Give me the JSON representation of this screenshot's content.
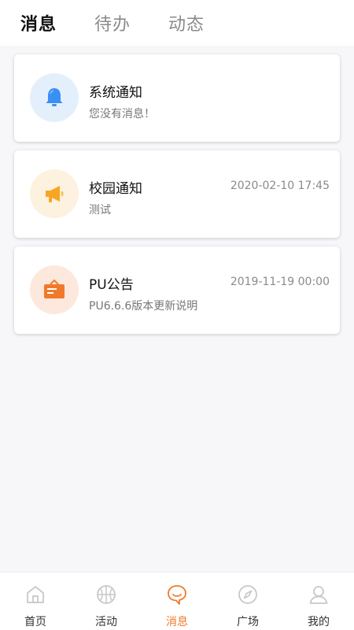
{
  "tabs": [
    {
      "label": "消息",
      "active": true
    },
    {
      "label": "待办",
      "active": false
    },
    {
      "label": "动态",
      "active": false
    }
  ],
  "cards": [
    {
      "title": "系统通知",
      "subtitle": "您没有消息！",
      "time": "",
      "icon": "bell-icon",
      "icon_color": "#3a8ff5",
      "icon_bg": "#e3f0fc"
    },
    {
      "title": "校园通知",
      "subtitle": "测试",
      "time": "2020-02-10 17:45",
      "icon": "megaphone-icon",
      "icon_color": "#f6a623",
      "icon_bg": "#fdf1df"
    },
    {
      "title": "PU公告",
      "subtitle": "PU6.6.6版本更新说明",
      "time": "2019-11-19 00:00",
      "icon": "notice-board-icon",
      "icon_color": "#f07a2b",
      "icon_bg": "#fde8dd"
    }
  ],
  "nav": [
    {
      "label": "首页",
      "icon": "home-icon",
      "active": false
    },
    {
      "label": "活动",
      "icon": "basketball-icon",
      "active": false
    },
    {
      "label": "消息",
      "icon": "chat-bubble-icon",
      "active": true
    },
    {
      "label": "广场",
      "icon": "compass-icon",
      "active": false
    },
    {
      "label": "我的",
      "icon": "user-icon",
      "active": false
    }
  ],
  "colors": {
    "accent": "#f07a2b",
    "inactive_icon": "#c8c8c8"
  }
}
